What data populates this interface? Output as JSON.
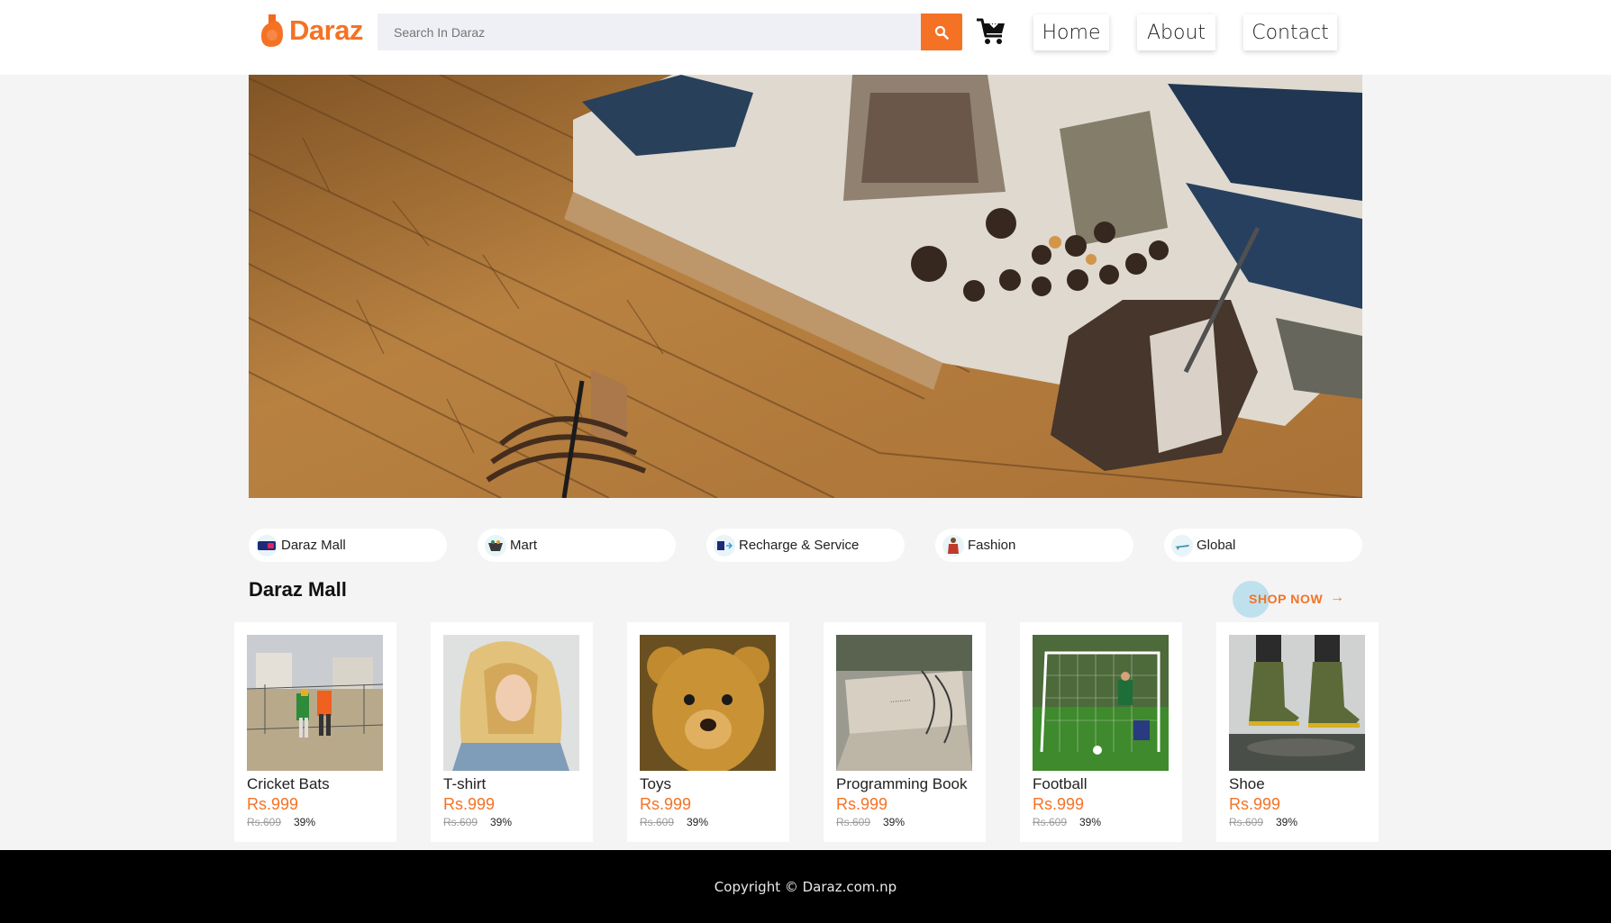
{
  "header": {
    "logo_text": "Daraz",
    "search_placeholder": "Search In Daraz",
    "nav": [
      {
        "label": "Home"
      },
      {
        "label": "About"
      },
      {
        "label": "Contact"
      }
    ]
  },
  "categories": [
    {
      "label": "Daraz Mall",
      "icon": "daraz-mall-icon"
    },
    {
      "label": "Mart",
      "icon": "mart-basket-icon"
    },
    {
      "label": "Recharge & Service",
      "icon": "recharge-icon"
    },
    {
      "label": "Fashion",
      "icon": "fashion-icon"
    },
    {
      "label": "Global",
      "icon": "global-plane-icon"
    }
  ],
  "section": {
    "title": "Daraz Mall",
    "shop_now": "SHOP NOW"
  },
  "products": [
    {
      "name": "Cricket Bats",
      "price": "Rs.999",
      "old_price": "Rs.609",
      "discount": "39%"
    },
    {
      "name": "T-shirt",
      "price": "Rs.999",
      "old_price": "Rs.609",
      "discount": "39%"
    },
    {
      "name": "Toys",
      "price": "Rs.999",
      "old_price": "Rs.609",
      "discount": "39%"
    },
    {
      "name": "Programming Book",
      "price": "Rs.999",
      "old_price": "Rs.609",
      "discount": "39%"
    },
    {
      "name": "Football",
      "price": "Rs.999",
      "old_price": "Rs.609",
      "discount": "39%"
    },
    {
      "name": "Shoe",
      "price": "Rs.999",
      "old_price": "Rs.609",
      "discount": "39%"
    }
  ],
  "footer": {
    "copyright": "Copyright © Daraz.com.np"
  },
  "colors": {
    "accent": "#f57224",
    "background": "#f4f4f4",
    "footer": "#000000"
  }
}
